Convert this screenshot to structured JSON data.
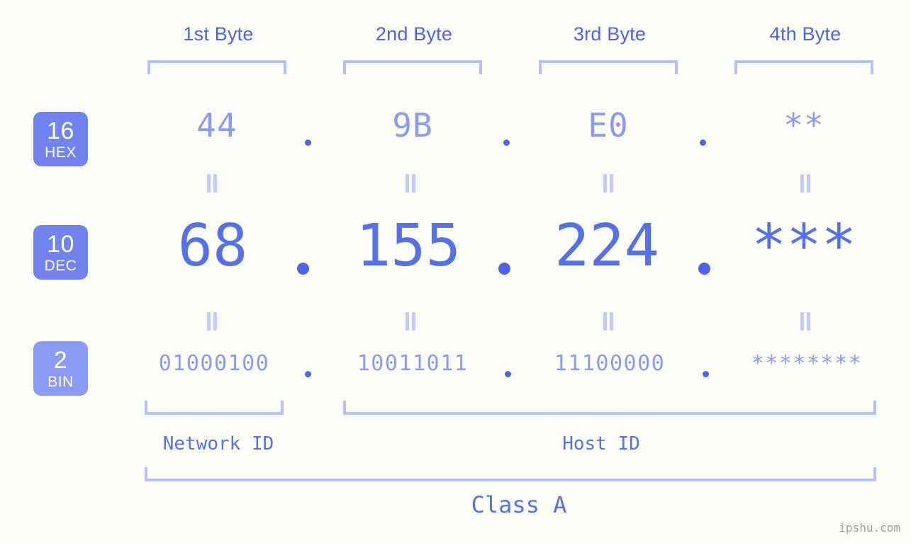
{
  "page": {
    "background_color": "#fcfdf7",
    "accent_color": "#5670ea",
    "accent_light_color": "#8b9bf4",
    "bracket_color": "#b6c0fb",
    "watermark": "ipshu.com"
  },
  "byte_headers": [
    {
      "label": "1st Byte"
    },
    {
      "label": "2nd Byte"
    },
    {
      "label": "3rd Byte"
    },
    {
      "label": "4th Byte"
    }
  ],
  "bases": [
    {
      "number": "16",
      "name": "HEX",
      "color": "#7083ee"
    },
    {
      "number": "10",
      "name": "DEC",
      "color": "#7083ee"
    },
    {
      "number": "2",
      "name": "BIN",
      "color": "#8b9bf4"
    }
  ],
  "rows": {
    "hex": {
      "values": [
        "44",
        "9B",
        "E0",
        "**"
      ]
    },
    "dec": {
      "values": [
        "68",
        "155",
        "224",
        "***"
      ]
    },
    "bin": {
      "values": [
        "01000100",
        "10011011",
        "11100000",
        "********"
      ]
    }
  },
  "separators": {
    "glyph": ".",
    "equals_glyph": "||"
  },
  "segments": {
    "network_id": "Network ID",
    "host_id": "Host ID",
    "class": "Class A"
  }
}
